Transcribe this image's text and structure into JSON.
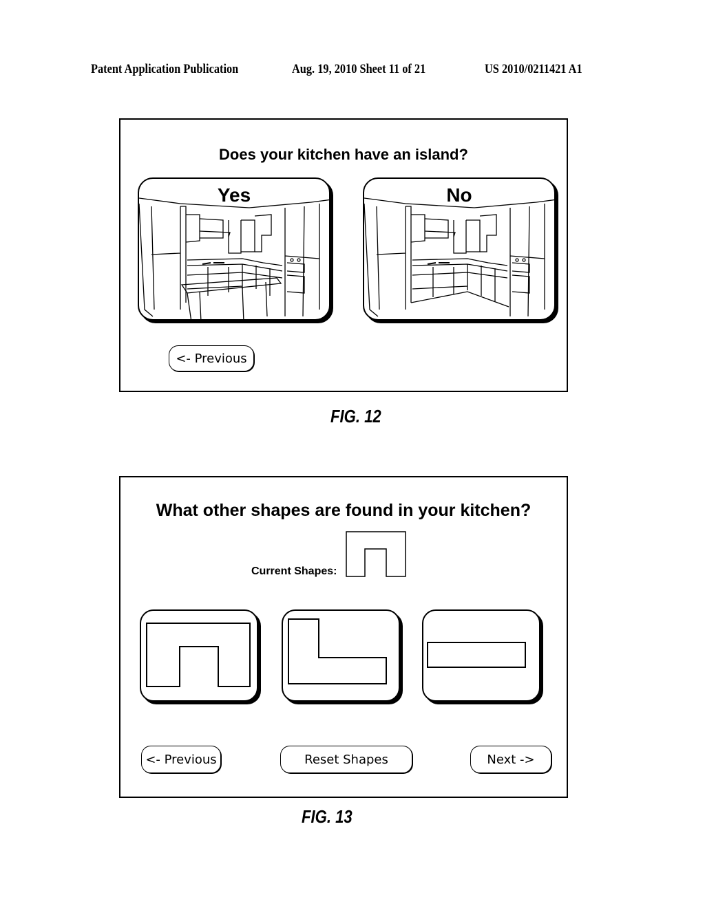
{
  "header": {
    "publication": "Patent Application Publication",
    "date_sheet": "Aug. 19, 2010  Sheet 11 of 21",
    "patent_number": "US 2010/0211421 A1"
  },
  "fig12": {
    "question": "Does your kitchen have an island?",
    "options": [
      {
        "label": "Yes",
        "image": "kitchen-with-island"
      },
      {
        "label": "No",
        "image": "kitchen-without-island"
      }
    ],
    "previous_label": "<- Previous",
    "caption": "FIG.  12"
  },
  "fig13": {
    "question": "What other shapes are found in your kitchen?",
    "current_shapes_label": "Current Shapes:",
    "current_shapes": [
      "u-shape"
    ],
    "shape_options": [
      "u-shape",
      "l-shape",
      "straight-line"
    ],
    "previous_label": "<- Previous",
    "reset_label": "Reset Shapes",
    "next_label": "Next ->",
    "caption": "FIG.  13"
  }
}
